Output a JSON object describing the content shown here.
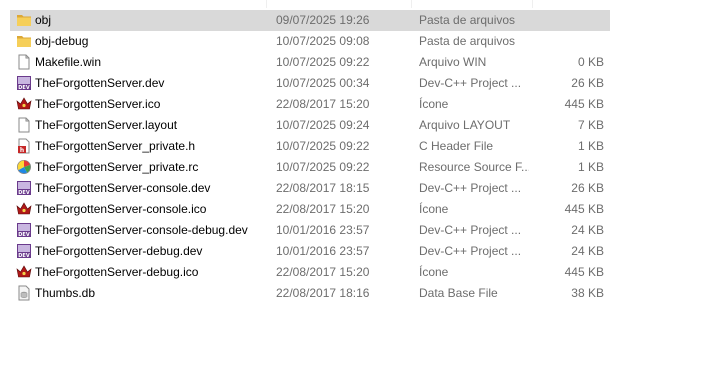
{
  "files": [
    {
      "name": "obj",
      "date": "09/07/2025 19:26",
      "type": "Pasta de arquivos",
      "size": "",
      "icon": "folder-icon",
      "selected": true
    },
    {
      "name": "obj-debug",
      "date": "10/07/2025 09:08",
      "type": "Pasta de arquivos",
      "size": "",
      "icon": "folder-icon",
      "selected": false
    },
    {
      "name": "Makefile.win",
      "date": "10/07/2025 09:22",
      "type": "Arquivo WIN",
      "size": "0 KB",
      "icon": "blank-file-icon",
      "selected": false
    },
    {
      "name": "TheForgottenServer.dev",
      "date": "10/07/2025 00:34",
      "type": "Dev-C++ Project ...",
      "size": "26 KB",
      "icon": "devcpp-project-icon",
      "selected": false
    },
    {
      "name": "TheForgottenServer.ico",
      "date": "22/08/2017 15:20",
      "type": "Ícone",
      "size": "445 KB",
      "icon": "crown-icon",
      "selected": false
    },
    {
      "name": "TheForgottenServer.layout",
      "date": "10/07/2025 09:24",
      "type": "Arquivo LAYOUT",
      "size": "7 KB",
      "icon": "blank-file-icon",
      "selected": false
    },
    {
      "name": "TheForgottenServer_private.h",
      "date": "10/07/2025 09:22",
      "type": "C Header File",
      "size": "1 KB",
      "icon": "c-header-icon",
      "selected": false
    },
    {
      "name": "TheForgottenServer_private.rc",
      "date": "10/07/2025 09:22",
      "type": "Resource Source F...",
      "size": "1 KB",
      "icon": "resource-file-icon",
      "selected": false
    },
    {
      "name": "TheForgottenServer-console.dev",
      "date": "22/08/2017 18:15",
      "type": "Dev-C++ Project ...",
      "size": "26 KB",
      "icon": "devcpp-project-icon",
      "selected": false
    },
    {
      "name": "TheForgottenServer-console.ico",
      "date": "22/08/2017 15:20",
      "type": "Ícone",
      "size": "445 KB",
      "icon": "crown-icon",
      "selected": false
    },
    {
      "name": "TheForgottenServer-console-debug.dev",
      "date": "10/01/2016 23:57",
      "type": "Dev-C++ Project ...",
      "size": "24 KB",
      "icon": "devcpp-project-icon",
      "selected": false
    },
    {
      "name": "TheForgottenServer-debug.dev",
      "date": "10/01/2016 23:57",
      "type": "Dev-C++ Project ...",
      "size": "24 KB",
      "icon": "devcpp-project-icon",
      "selected": false
    },
    {
      "name": "TheForgottenServer-debug.ico",
      "date": "22/08/2017 15:20",
      "type": "Ícone",
      "size": "445 KB",
      "icon": "crown-icon",
      "selected": false
    },
    {
      "name": "Thumbs.db",
      "date": "22/08/2017 18:16",
      "type": "Data Base File",
      "size": "38 KB",
      "icon": "database-file-icon",
      "selected": false
    }
  ],
  "colors": {
    "selection": "#d9d9d9",
    "secondary_text": "#6d6d6d",
    "folder": "#f0c24b"
  }
}
